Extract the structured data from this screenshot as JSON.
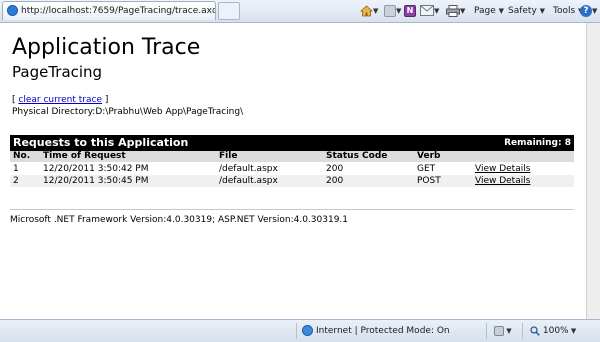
{
  "browser": {
    "tab_title": "http://localhost:7659/PageTracing/trace.axd",
    "commands": {
      "page": "Page",
      "safety": "Safety",
      "tools": "Tools",
      "help_glyph": "?"
    },
    "status": {
      "zone": "Internet | Protected Mode: On",
      "zoom": "100%"
    }
  },
  "page": {
    "title": "Application Trace",
    "app_name": "PageTracing",
    "clear_open": "[",
    "clear_link": "clear current trace",
    "clear_close": "]",
    "physical_directory": "Physical Directory:D:\\Prabhu\\Web App\\PageTracing\\",
    "requests": {
      "title": "Requests to this Application",
      "remaining": "Remaining: 8",
      "columns": [
        "No.",
        "Time of Request",
        "File",
        "Status Code",
        "Verb",
        ""
      ],
      "rows": [
        {
          "no": "1",
          "time": "12/20/2011 3:50:42 PM",
          "file": "/default.aspx",
          "status": "200",
          "verb": "GET",
          "details": "View Details"
        },
        {
          "no": "2",
          "time": "12/20/2011 3:50:45 PM",
          "file": "/default.aspx",
          "status": "200",
          "verb": "POST",
          "details": "View Details"
        }
      ]
    },
    "version_info": "Microsoft .NET Framework Version:4.0.30319; ASP.NET Version:4.0.30319.1"
  },
  "icons": [
    "ie-page-icon",
    "home-icon",
    "rss-feed-icon",
    "onenote-icon",
    "mail-icon",
    "print-icon",
    "help-icon",
    "protected-mode-globe-icon",
    "zoom-icon"
  ],
  "colors": {
    "link": "#0000cc",
    "section_header_bg": "#000000",
    "column_header_bg": "#dcdcdc",
    "alt_row_bg": "#f0f0f0"
  }
}
